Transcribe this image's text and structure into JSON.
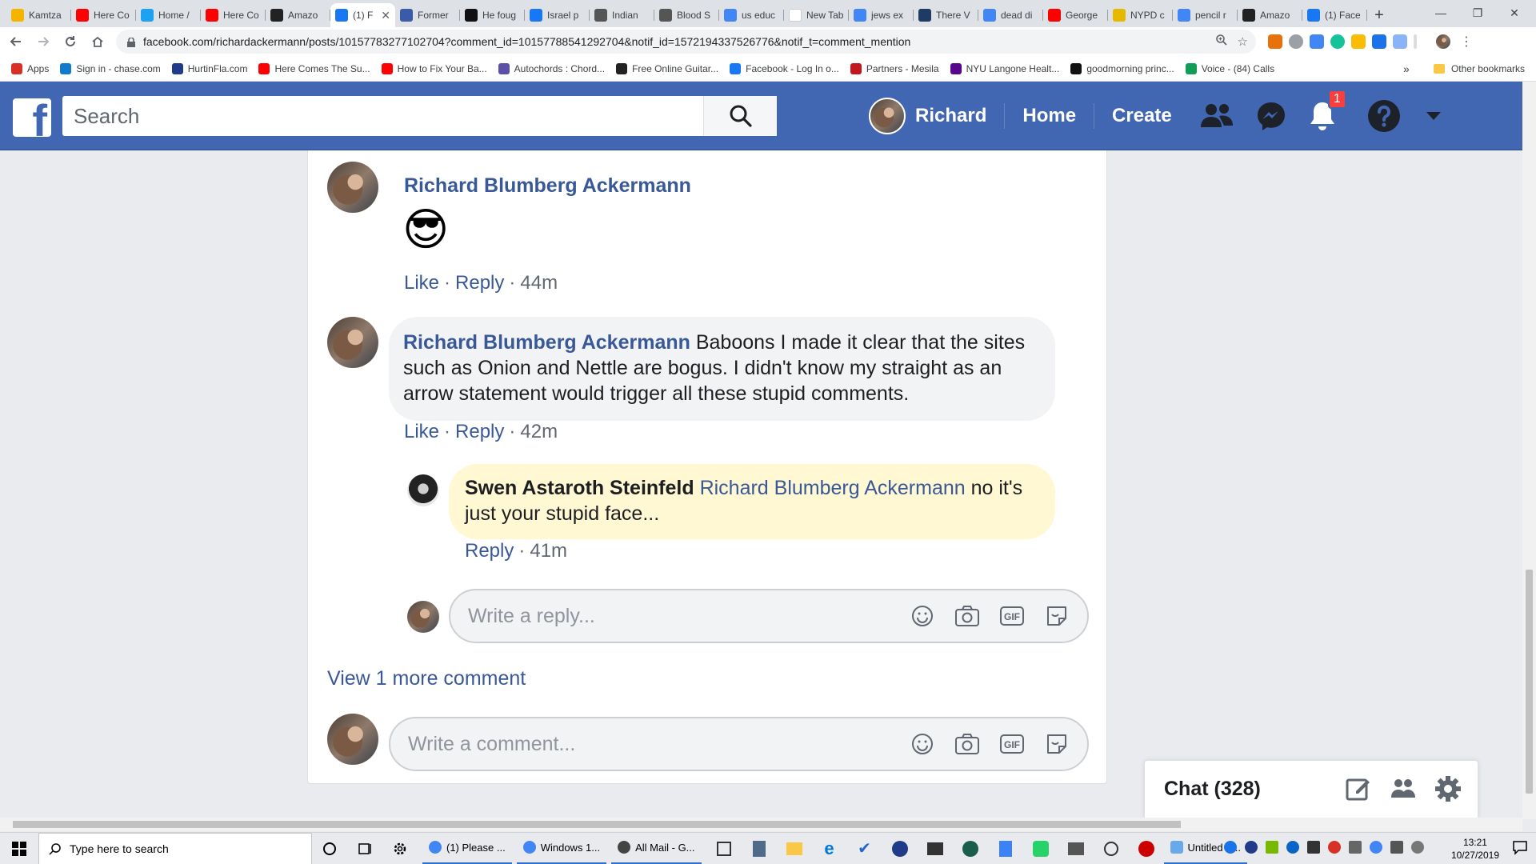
{
  "browser": {
    "tabs": [
      {
        "title": "Kamtza",
        "color": "#f4b400"
      },
      {
        "title": "Here Co",
        "color": "#ff0000"
      },
      {
        "title": "Home /",
        "color": "#1da1f2"
      },
      {
        "title": "Here Co",
        "color": "#ff0000"
      },
      {
        "title": "Amazo",
        "color": "#222222"
      },
      {
        "title": "(1) F",
        "color": "#1877f2",
        "active": true
      },
      {
        "title": "Former",
        "color": "#3a5ca8"
      },
      {
        "title": "He foug",
        "color": "#111111"
      },
      {
        "title": "Israel p",
        "color": "#1877f2"
      },
      {
        "title": "Indian",
        "color": "#555555"
      },
      {
        "title": "Blood S",
        "color": "#555555"
      },
      {
        "title": "us educ",
        "color": "#4285f4"
      },
      {
        "title": "New Tab",
        "color": "#ffffff"
      },
      {
        "title": "jews ex",
        "color": "#4285f4"
      },
      {
        "title": "There V",
        "color": "#1f3b63"
      },
      {
        "title": "dead di",
        "color": "#4285f4"
      },
      {
        "title": "George",
        "color": "#ff0000"
      },
      {
        "title": "NYPD c",
        "color": "#e6b800"
      },
      {
        "title": "pencil r",
        "color": "#4285f4"
      },
      {
        "title": "Amazo",
        "color": "#222222"
      },
      {
        "title": "(1) Face",
        "color": "#1877f2"
      }
    ],
    "tab_close_glyph": "✕",
    "new_tab_glyph": "+",
    "window_controls": [
      "—",
      "❐",
      "✕"
    ],
    "url": "facebook.com/richardackermann/posts/10157783277102704?comment_id=10157788541292704&notif_id=1572194337526776&notif_t=comment_mention",
    "bookmarks": [
      {
        "label": "Apps",
        "color": "#d93025"
      },
      {
        "label": "Sign in - chase.com",
        "color": "#117aca"
      },
      {
        "label": "HurtinFla.com",
        "color": "#1f3b8a"
      },
      {
        "label": "Here Comes The Su...",
        "color": "#ff0000"
      },
      {
        "label": "How to Fix Your Ba...",
        "color": "#ff0000"
      },
      {
        "label": "Autochords : Chord...",
        "color": "#5b4fa8"
      },
      {
        "label": "Free Online Guitar...",
        "color": "#222222"
      },
      {
        "label": "Facebook - Log In o...",
        "color": "#1877f2"
      },
      {
        "label": "Partners - Mesila",
        "color": "#c4161c"
      },
      {
        "label": "NYU Langone Healt...",
        "color": "#57068c"
      },
      {
        "label": "goodmorning princ...",
        "color": "#111111"
      },
      {
        "label": "Voice - (84) Calls",
        "color": "#0f9d58"
      }
    ],
    "bookmarks_overflow": "»",
    "other_bookmarks": "Other bookmarks"
  },
  "facebook": {
    "logo": "f",
    "search_placeholder": "Search",
    "user_name": "Richard",
    "nav_home": "Home",
    "nav_create": "Create",
    "notif_count": "1",
    "colors": {
      "brand": "#4267b2",
      "link": "#385898",
      "highlight": "#fff8d3"
    }
  },
  "comments": [
    {
      "author": "Richard Blumberg Ackermann",
      "emoji": "😎",
      "actions": {
        "like": "Like",
        "reply": "Reply",
        "time": "44m"
      }
    },
    {
      "author": "Richard Blumberg Ackermann",
      "text": "Baboons I made it clear that the sites such as Onion and Nettle are bogus. I didn't know my straight as an arrow statement would trigger all these stupid comments.",
      "actions": {
        "like": "Like",
        "reply": "Reply",
        "time": "42m"
      }
    }
  ],
  "reply": {
    "author": "Swen Astaroth Steinfeld",
    "mention": "Richard Blumberg Ackermann",
    "text": "no it's just your stupid face...",
    "actions": {
      "reply": "Reply",
      "time": "41m"
    }
  },
  "reply_box_placeholder": "Write a reply...",
  "view_more": "View 1 more comment",
  "comment_box_placeholder": "Write a comment...",
  "separator": "·",
  "gif_label": "GIF",
  "chat": {
    "label": "Chat (328)"
  },
  "taskbar": {
    "search_placeholder": "Type here to search",
    "apps": [
      {
        "label": "(1) Please ...",
        "color": "#4285f4"
      },
      {
        "label": "Windows 1...",
        "color": "#4285f4"
      },
      {
        "label": "All Mail - G...",
        "color": "#444444"
      }
    ],
    "paint_label": "Untitled - ...",
    "time": "13:21",
    "date": "10/27/2019"
  }
}
